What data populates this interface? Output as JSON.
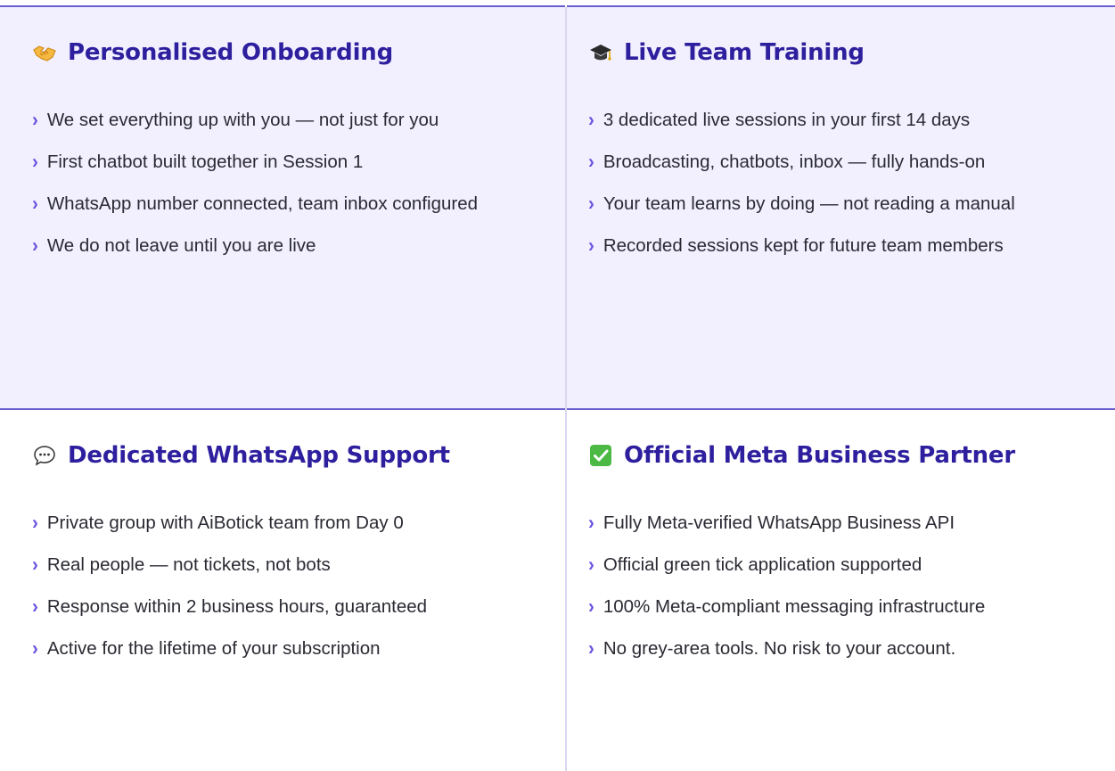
{
  "cards": [
    {
      "title": "Personalised Onboarding",
      "icon": "handshake-icon",
      "items": [
        "We set everything up with you — not just for you",
        "First chatbot built together in Session 1",
        "WhatsApp number connected, team inbox configured",
        "We do not leave until you are live"
      ]
    },
    {
      "title": "Live Team Training",
      "icon": "graduation-cap-icon",
      "items": [
        "3 dedicated live sessions in your first 14 days",
        "Broadcasting, chatbots, inbox — fully hands-on",
        "Your team learns by doing — not reading a manual",
        "Recorded sessions kept for future team members"
      ]
    },
    {
      "title": "Dedicated WhatsApp Support",
      "icon": "speech-bubble-icon",
      "items": [
        "Private group with AiBotick team from Day 0",
        "Real people — not tickets, not bots",
        "Response within 2 business hours, guaranteed",
        "Active for the lifetime of your subscription"
      ]
    },
    {
      "title": "Official Meta Business Partner",
      "icon": "check-mark-icon",
      "items": [
        "Fully Meta-verified WhatsApp Business API",
        "Official green tick application supported",
        "100% Meta-compliant messaging infrastructure",
        "No grey-area tools. No risk to your account."
      ]
    }
  ],
  "colors": {
    "accent": "#2e1f9e",
    "bullet": "#6b55e0",
    "border": "#6a5fd0",
    "card_bg_top": "#f2f0ff",
    "text": "#2a2a33"
  }
}
